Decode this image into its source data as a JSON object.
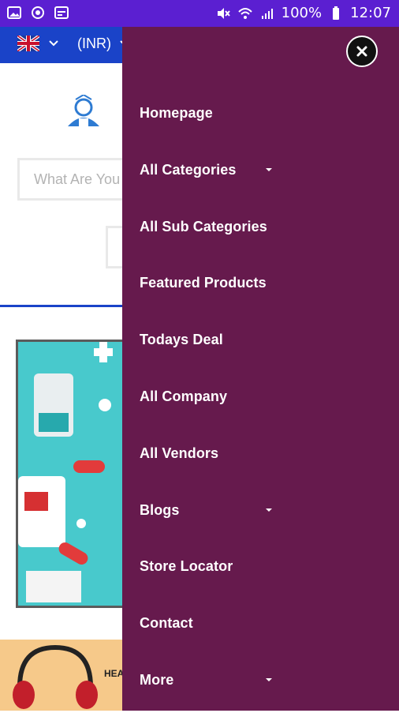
{
  "status_bar": {
    "battery": "100%",
    "time": "12:07",
    "left_icons": [
      "image-icon",
      "settings-circle-icon",
      "calendar-icon"
    ],
    "right_icons": [
      "mute-icon",
      "wifi-icon",
      "signal-icon",
      "battery-icon"
    ]
  },
  "top_bar": {
    "currency": "(INR)"
  },
  "header": {
    "search_placeholder": "What Are You"
  },
  "promo": {
    "text": "HEA"
  },
  "drawer": {
    "menu": [
      {
        "label": "Homepage",
        "has_dropdown": false
      },
      {
        "label": "All Categories",
        "has_dropdown": true
      },
      {
        "label": "All Sub Categories",
        "has_dropdown": false
      },
      {
        "label": "Featured Products",
        "has_dropdown": false
      },
      {
        "label": "Todays Deal",
        "has_dropdown": false
      },
      {
        "label": "All Company",
        "has_dropdown": false
      },
      {
        "label": "All Vendors",
        "has_dropdown": false
      },
      {
        "label": "Blogs",
        "has_dropdown": true
      },
      {
        "label": "Store Locator",
        "has_dropdown": false
      },
      {
        "label": "Contact",
        "has_dropdown": false
      },
      {
        "label": "More",
        "has_dropdown": true
      }
    ]
  },
  "colors": {
    "status_bar": "#5b1fd1",
    "top_bar": "#1a43c8",
    "drawer": "#661a4d",
    "close_button": "#111111"
  }
}
